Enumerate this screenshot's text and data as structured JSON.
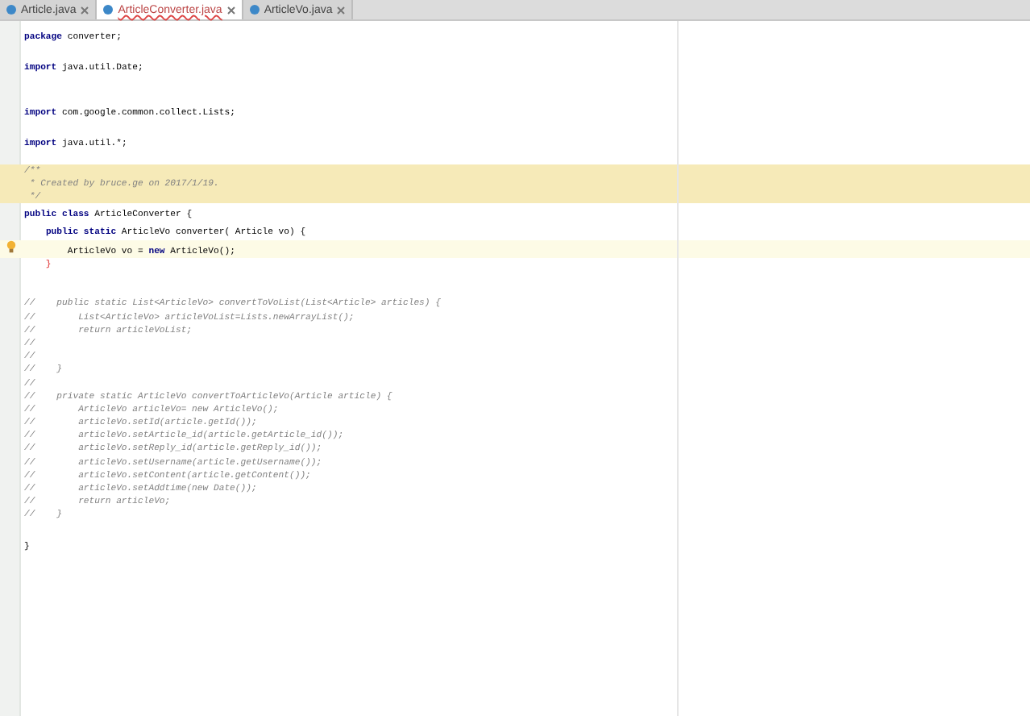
{
  "tabs": [
    {
      "label": "Article.java",
      "selected": false
    },
    {
      "label": "ArticleConverter.java",
      "selected": true
    },
    {
      "label": "ArticleVo.java",
      "selected": false
    }
  ],
  "lines": [
    {
      "kind": "code",
      "text": "**package** converter;",
      "current": false
    },
    {
      "kind": "blank",
      "current": false
    },
    {
      "kind": "code",
      "text": "**import** java.util.Date;",
      "current": false
    },
    {
      "kind": "blank",
      "current": false
    },
    {
      "kind": "blank",
      "current": false
    },
    {
      "kind": "code",
      "text": "**import** com.google.common.collect.Lists;",
      "current": false
    },
    {
      "kind": "blank",
      "current": false
    },
    {
      "kind": "code",
      "text": "**import** java.util.*;",
      "current": false
    },
    {
      "kind": "blank",
      "current": false
    },
    {
      "kind": "doc",
      "text": "/**",
      "current": false
    },
    {
      "kind": "doc",
      "text": " * Created by bruce.ge on 2017/1/19.",
      "current": false
    },
    {
      "kind": "doc",
      "text": " */",
      "current": false
    },
    {
      "kind": "code",
      "text": "**public class** ArticleConverter {",
      "current": false
    },
    {
      "kind": "code",
      "text": "    **public static** ArticleVo converter( Article vo) {",
      "current": false
    },
    {
      "kind": "code",
      "text": "        ArticleVo vo = **new** ArticleVo();",
      "current": true,
      "bulb": true
    },
    {
      "kind": "error",
      "text": "    }",
      "current": false
    },
    {
      "kind": "blank",
      "current": false
    },
    {
      "kind": "blank",
      "current": false
    },
    {
      "kind": "comment",
      "text": "//    public static List<ArticleVo> convertToVoList(List<Article> articles) {",
      "current": false
    },
    {
      "kind": "comment",
      "text": "//        List<ArticleVo> articleVoList=Lists.newArrayList();",
      "current": false
    },
    {
      "kind": "comment",
      "text": "//        return articleVoList;",
      "current": false
    },
    {
      "kind": "comment",
      "text": "//",
      "current": false
    },
    {
      "kind": "comment",
      "text": "//",
      "current": false
    },
    {
      "kind": "comment",
      "text": "//    }",
      "current": false
    },
    {
      "kind": "comment",
      "text": "//",
      "current": false
    },
    {
      "kind": "comment",
      "text": "//    private static ArticleVo convertToArticleVo(Article article) {",
      "current": false
    },
    {
      "kind": "comment",
      "text": "//        ArticleVo articleVo= new ArticleVo();",
      "current": false
    },
    {
      "kind": "comment",
      "text": "//        articleVo.setId(article.getId());",
      "current": false
    },
    {
      "kind": "comment",
      "text": "//        articleVo.setArticle_id(article.getArticle_id());",
      "current": false
    },
    {
      "kind": "comment",
      "text": "//        articleVo.setReply_id(article.getReply_id());",
      "current": false
    },
    {
      "kind": "comment",
      "text": "//        articleVo.setUsername(article.getUsername());",
      "current": false
    },
    {
      "kind": "comment",
      "text": "//        articleVo.setContent(article.getContent());",
      "current": false
    },
    {
      "kind": "comment",
      "text": "//        articleVo.setAddtime(new Date());",
      "current": false
    },
    {
      "kind": "comment",
      "text": "//        return articleVo;",
      "current": false
    },
    {
      "kind": "comment",
      "text": "//    }",
      "current": false
    },
    {
      "kind": "blank",
      "current": false
    },
    {
      "kind": "code",
      "text": "}",
      "current": false
    }
  ]
}
